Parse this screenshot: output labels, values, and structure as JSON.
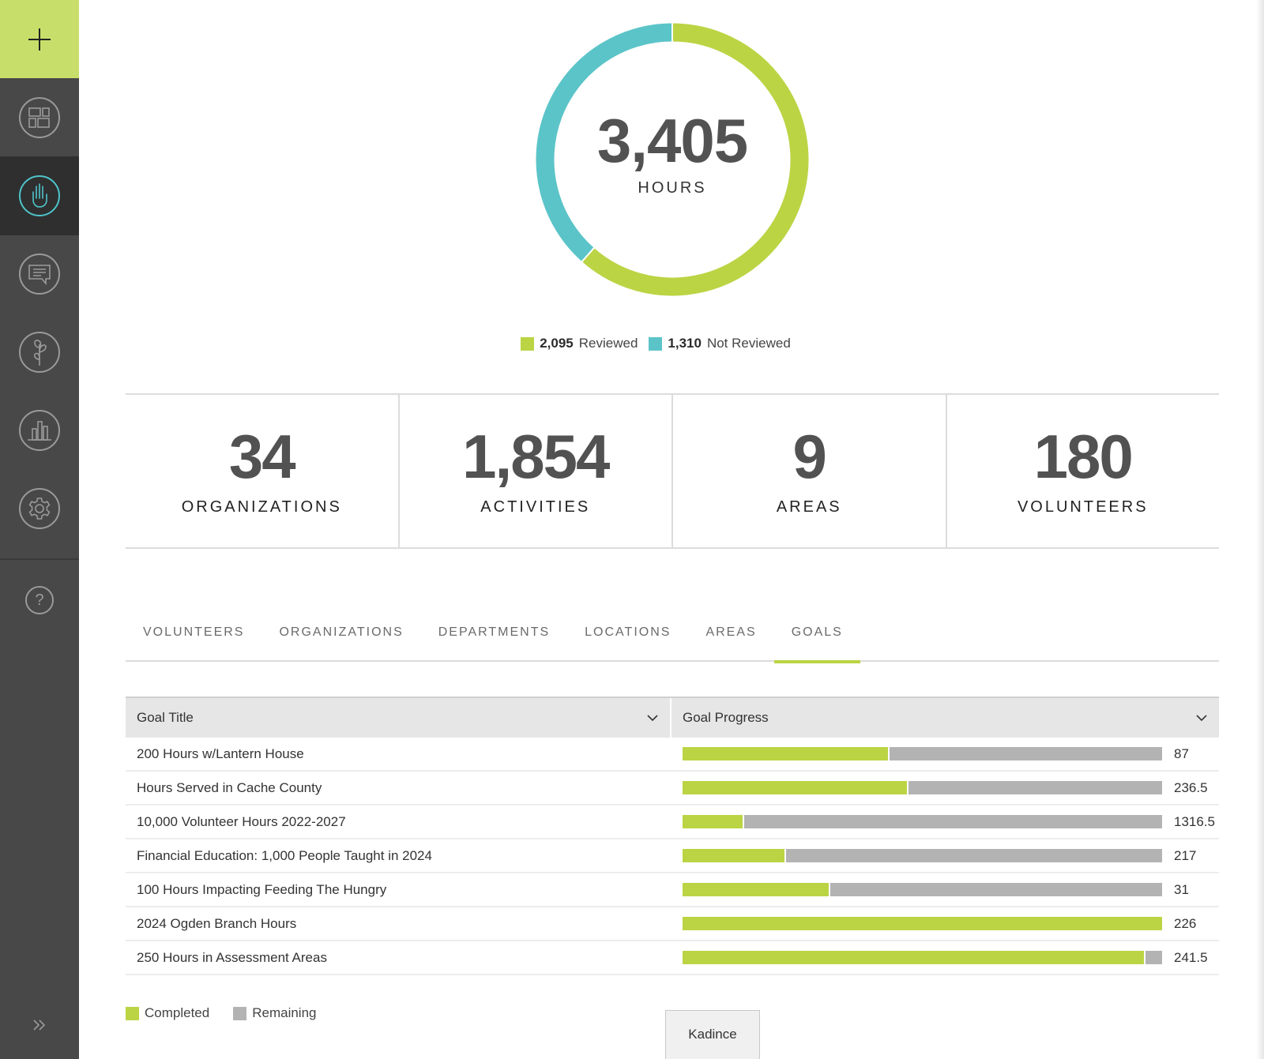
{
  "colors": {
    "accent_green": "#bbd444",
    "accent_teal": "#5bc4c8",
    "remaining_gray": "#b3b3b3",
    "sidebar_bg": "#484848",
    "sidebar_active_bg": "#2f2f2f",
    "add_button_bg": "#c7df6a"
  },
  "sidebar": {
    "add_icon": "plus-icon",
    "items": [
      {
        "name": "dashboard",
        "icon": "dashboard-grid-icon",
        "active": false
      },
      {
        "name": "volunteer",
        "icon": "raised-hand-icon",
        "active": true
      },
      {
        "name": "messages",
        "icon": "chat-message-icon",
        "active": false
      },
      {
        "name": "growth",
        "icon": "plant-sprout-icon",
        "active": false
      },
      {
        "name": "reports",
        "icon": "bar-chart-icon",
        "active": false
      },
      {
        "name": "settings",
        "icon": "gear-icon",
        "active": false
      }
    ],
    "help_icon": "question-icon",
    "help_glyph": "?",
    "expand_icon": "double-chevron-right-icon"
  },
  "hours": {
    "total": "3,405",
    "label": "HOURS",
    "reviewed_value": "2,095",
    "reviewed_label": "Reviewed",
    "not_reviewed_value": "1,310",
    "not_reviewed_label": "Not Reviewed"
  },
  "chart_data": [
    {
      "type": "pie",
      "title": "3,405 HOURS",
      "categories": [
        "Reviewed",
        "Not Reviewed"
      ],
      "values": [
        2095,
        1310
      ],
      "colors": [
        "#bbd444",
        "#5bc4c8"
      ],
      "legend": "bottom"
    },
    {
      "type": "bar",
      "title": "Goal Progress",
      "orientation": "horizontal-stacked",
      "categories": [
        "200 Hours w/Lantern House",
        "Hours Served in Cache County",
        "10,000 Volunteer Hours 2022-2027",
        "Financial Education: 1,000 People Taught in 2024",
        "100 Hours Impacting Feeding The Hungry",
        "2024 Ogden Branch Hours",
        "250 Hours in Assessment Areas"
      ],
      "series": [
        {
          "name": "Completed",
          "values_fraction": [
            0.432,
            0.471,
            0.129,
            0.215,
            0.308,
            1.0,
            0.965
          ]
        },
        {
          "name": "Remaining",
          "values_fraction": [
            0.568,
            0.529,
            0.871,
            0.785,
            0.692,
            0.0,
            0.035
          ]
        }
      ],
      "value_labels": [
        "87",
        "236.5",
        "1316.5",
        "217",
        "31",
        "226",
        "241.5"
      ],
      "legend": "bottom-left"
    }
  ],
  "stats": [
    {
      "value": "34",
      "label": "ORGANIZATIONS"
    },
    {
      "value": "1,854",
      "label": "ACTIVITIES"
    },
    {
      "value": "9",
      "label": "AREAS"
    },
    {
      "value": "180",
      "label": "VOLUNTEERS"
    }
  ],
  "tabs": [
    {
      "label": "VOLUNTEERS",
      "active": false
    },
    {
      "label": "ORGANIZATIONS",
      "active": false
    },
    {
      "label": "DEPARTMENTS",
      "active": false
    },
    {
      "label": "LOCATIONS",
      "active": false
    },
    {
      "label": "AREAS",
      "active": false
    },
    {
      "label": "GOALS",
      "active": true
    }
  ],
  "goals_table": {
    "col_title": "Goal Title",
    "col_progress": "Goal Progress",
    "rows": [
      {
        "title": "200 Hours w/Lantern House",
        "completed_fraction": 0.432,
        "value": "87"
      },
      {
        "title": "Hours Served in Cache County",
        "completed_fraction": 0.471,
        "value": "236.5"
      },
      {
        "title": "10,000 Volunteer Hours 2022-2027",
        "completed_fraction": 0.129,
        "value": "1316.5"
      },
      {
        "title": "Financial Education: 1,000 People Taught in 2024",
        "completed_fraction": 0.215,
        "value": "217"
      },
      {
        "title": "100 Hours Impacting Feeding The Hungry",
        "completed_fraction": 0.308,
        "value": "31"
      },
      {
        "title": "2024 Ogden Branch Hours",
        "completed_fraction": 1.0,
        "value": "226"
      },
      {
        "title": "250 Hours in Assessment Areas",
        "completed_fraction": 0.965,
        "value": "241.5"
      }
    ],
    "legend_completed": "Completed",
    "legend_remaining": "Remaining"
  },
  "footer": {
    "kadince_label": "Kadince"
  }
}
